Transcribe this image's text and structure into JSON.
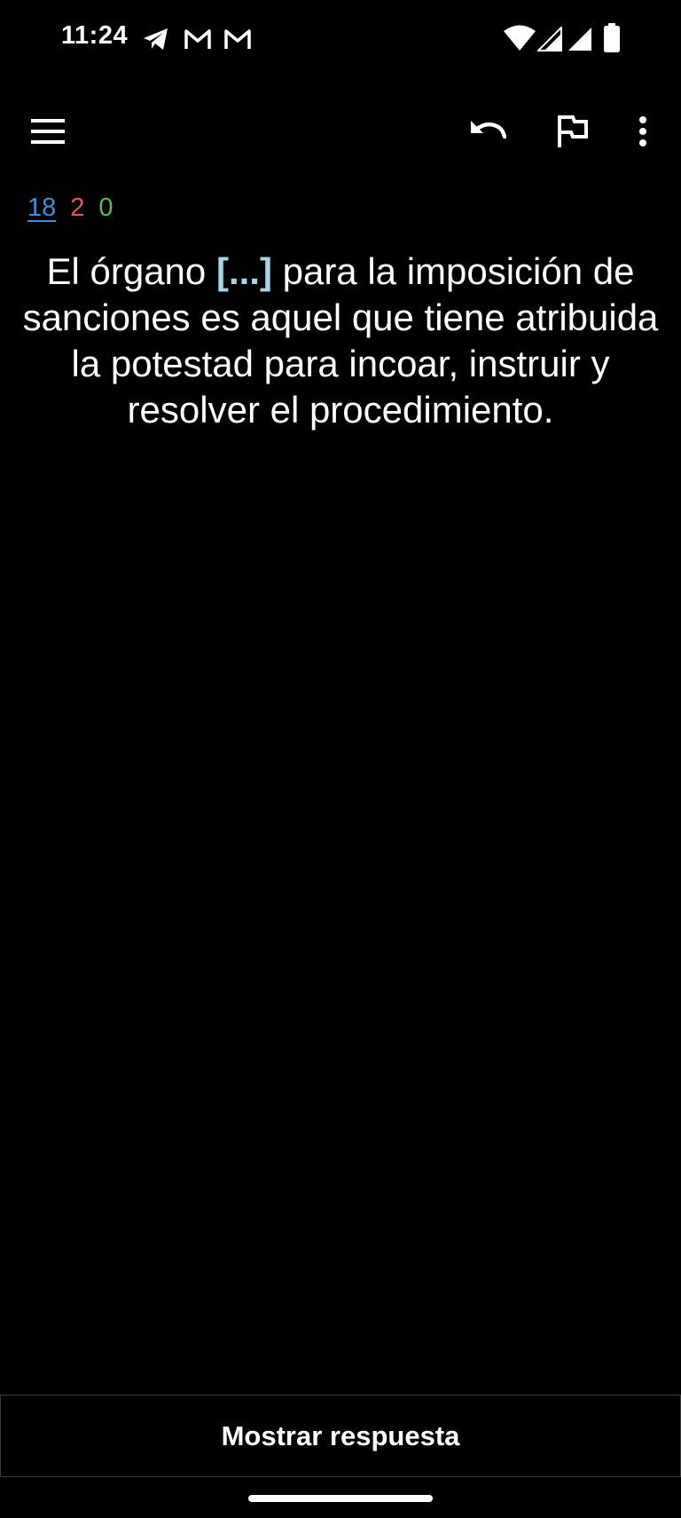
{
  "status_bar": {
    "time": "11:24",
    "icons": [
      "telegram-icon",
      "gmail-icon",
      "gmail-icon",
      "wifi-icon",
      "signal-icon",
      "signal-icon",
      "battery-icon"
    ]
  },
  "toolbar": {
    "menu_icon": "menu-icon",
    "undo_icon": "undo-icon",
    "flag_icon": "flag-icon",
    "more_icon": "more-vert-icon"
  },
  "counts": {
    "new": "18",
    "learning": "2",
    "review": "0",
    "colors": {
      "new": "#3f8fd6",
      "learning": "#e05a5a",
      "review": "#5db85a"
    }
  },
  "card": {
    "before": "El órgano ",
    "cloze": "[...]",
    "after": " para la imposición de sanciones es aquel que tiene atribuida la potestad para incoar, instruir y resolver el procedimiento.",
    "cloze_color": "#a8d4e6"
  },
  "answer_button": {
    "label": "Mostrar respuesta"
  }
}
